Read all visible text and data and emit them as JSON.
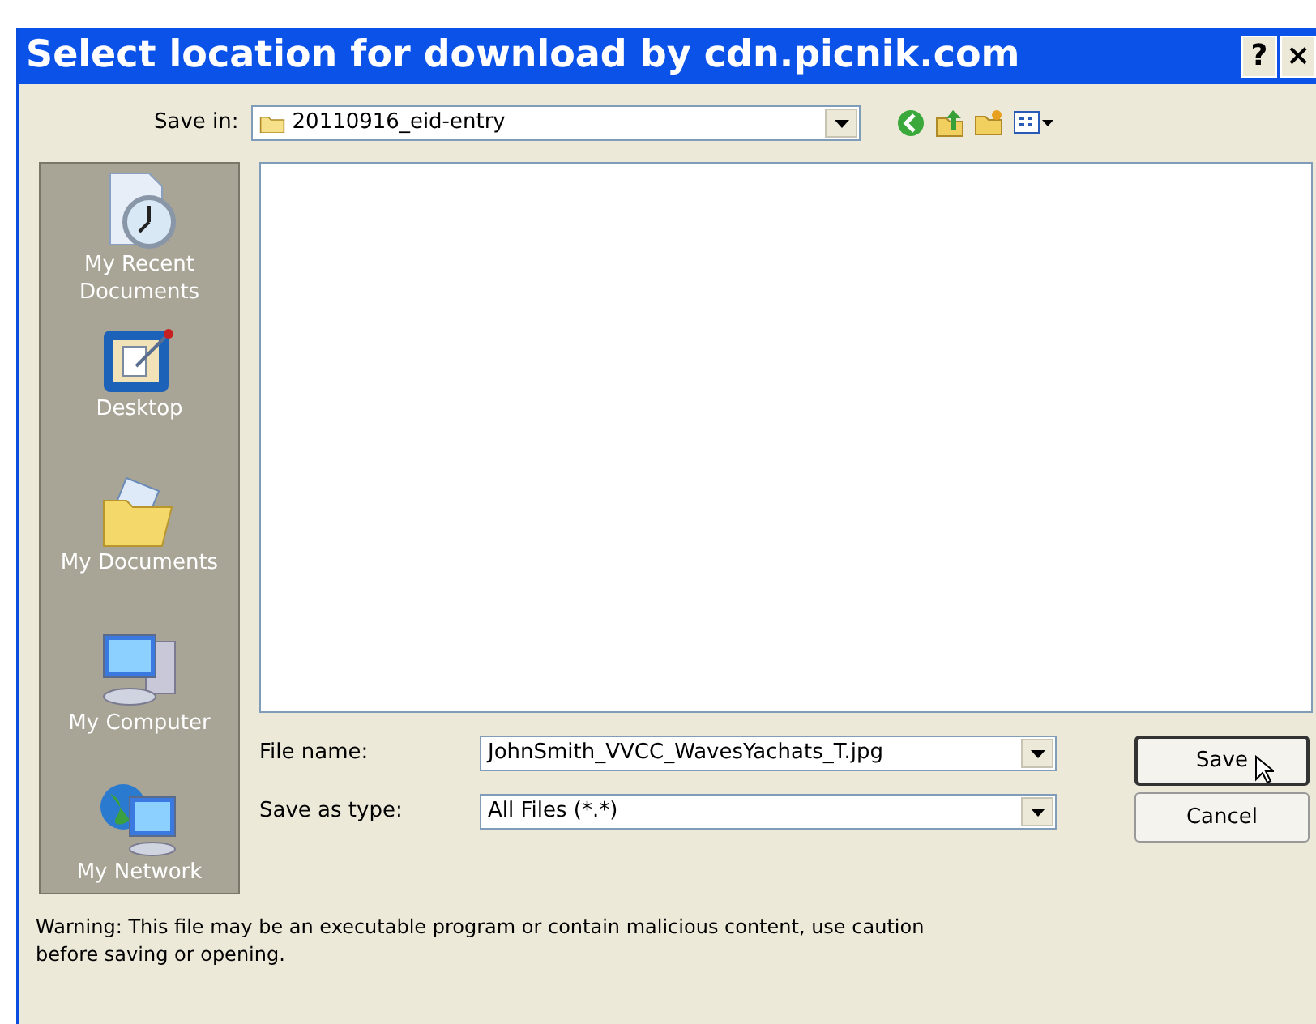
{
  "window": {
    "title": "Select location for download by cdn.picnik.com",
    "title_buttons": [
      "?",
      "×"
    ]
  },
  "save_in": {
    "label": "Save in:",
    "value": "20110916_eid-entry"
  },
  "places": [
    {
      "label": "My Recent Documents"
    },
    {
      "label": "Desktop"
    },
    {
      "label": "My Documents"
    },
    {
      "label": "My Computer"
    },
    {
      "label": "My Network"
    }
  ],
  "file_name": {
    "label": "File name:",
    "value": "JohnSmith_VVCC_WavesYachats_T.jpg"
  },
  "save_as_type": {
    "label": "Save as type:",
    "value": "All Files (*.*)"
  },
  "buttons": [
    "Save",
    "Cancel"
  ],
  "warning": "Warning: This file may be an executable program or contain malicious content, use caution before saving or opening."
}
